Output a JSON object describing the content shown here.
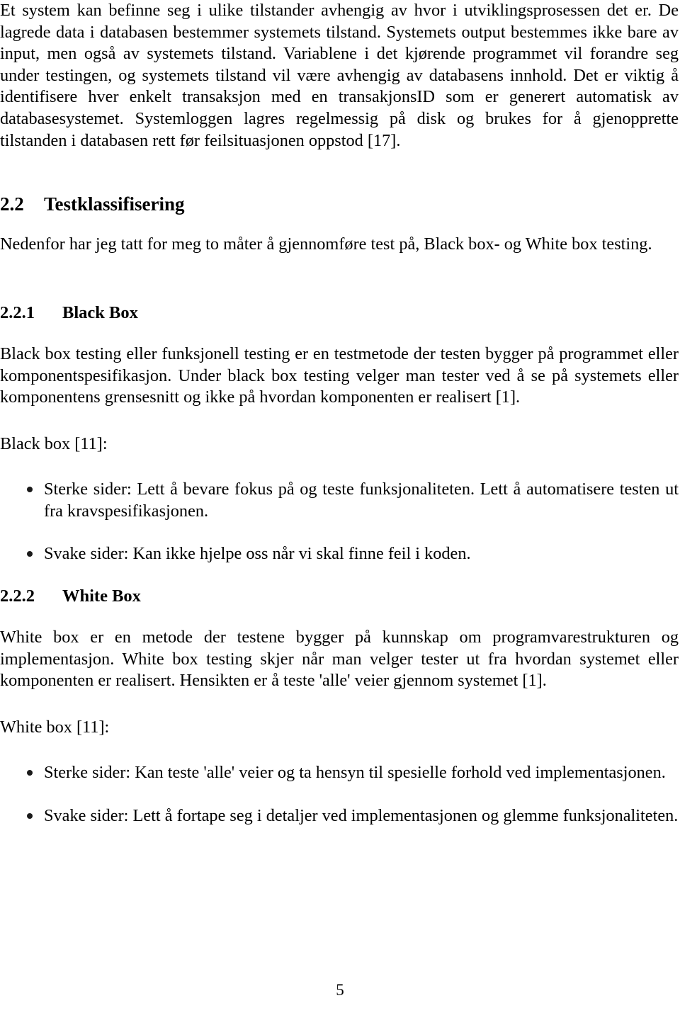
{
  "document": {
    "language": "no",
    "page_number": "5",
    "body_text_color": "#000000",
    "background_color": "#ffffff"
  },
  "paragraphs": {
    "system_state": "Et system kan befinne seg i ulike tilstander avhengig av hvor i utviklingsprosessen det er. De lagrede data i databasen bestemmer systemets tilstand. Systemets output bestemmes ikke bare av input, men også av systemets tilstand. Variablene i det kjørende programmet vil forandre seg under testingen, og systemets tilstand vil være avhengig av databasens innhold. Det er viktig å identifisere hver enkelt transaksjon med en transakjonsID som er generert automatisk av databasesystemet. Systemloggen lagres regelmessig på disk og brukes for å gjenopprette tilstanden i databasen rett før feilsituasjonen oppstod [17].",
    "testklassifisering_intro": "Nedenfor har jeg tatt for meg to måter å gjennomføre test på, Black box- og White box testing.",
    "black_box_body": "Black box testing eller funksjonell testing er en testmetode der testen bygger på programmet eller komponentspesifikasjon. Under black box testing velger man tester ved å se på systemets eller komponentens grensesnitt og ikke på hvordan komponenten er realisert [1].",
    "black_box_list_lead": "Black box [11]:",
    "white_box_body": "White box er en metode der testene bygger på kunnskap om programvarestrukturen og implementasjon. White box testing skjer når man velger tester ut fra hvordan systemet eller komponenten er realisert. Hensikten er å teste 'alle' veier gjennom systemet [1].",
    "white_box_list_lead": "White box [11]:"
  },
  "headings": {
    "section_22": {
      "number": "2.2",
      "title": "Testklassifisering"
    },
    "subsection_221": {
      "number": "2.2.1",
      "title": "Black Box"
    },
    "subsection_222": {
      "number": "2.2.2",
      "title": "White Box"
    }
  },
  "black_box_bullets": [
    "Sterke sider: Lett å bevare fokus på og teste funksjonaliteten. Lett å automatisere testen ut fra kravspesifikasjonen.",
    "Svake sider: Kan ikke hjelpe oss når vi skal finne feil i koden."
  ],
  "white_box_bullets": [
    "Sterke sider: Kan teste 'alle' veier og ta hensyn til spesielle forhold ved implementasjonen.",
    "Svake sider: Lett å fortape seg i detaljer ved implementasjonen og glemme funksjonaliteten."
  ]
}
